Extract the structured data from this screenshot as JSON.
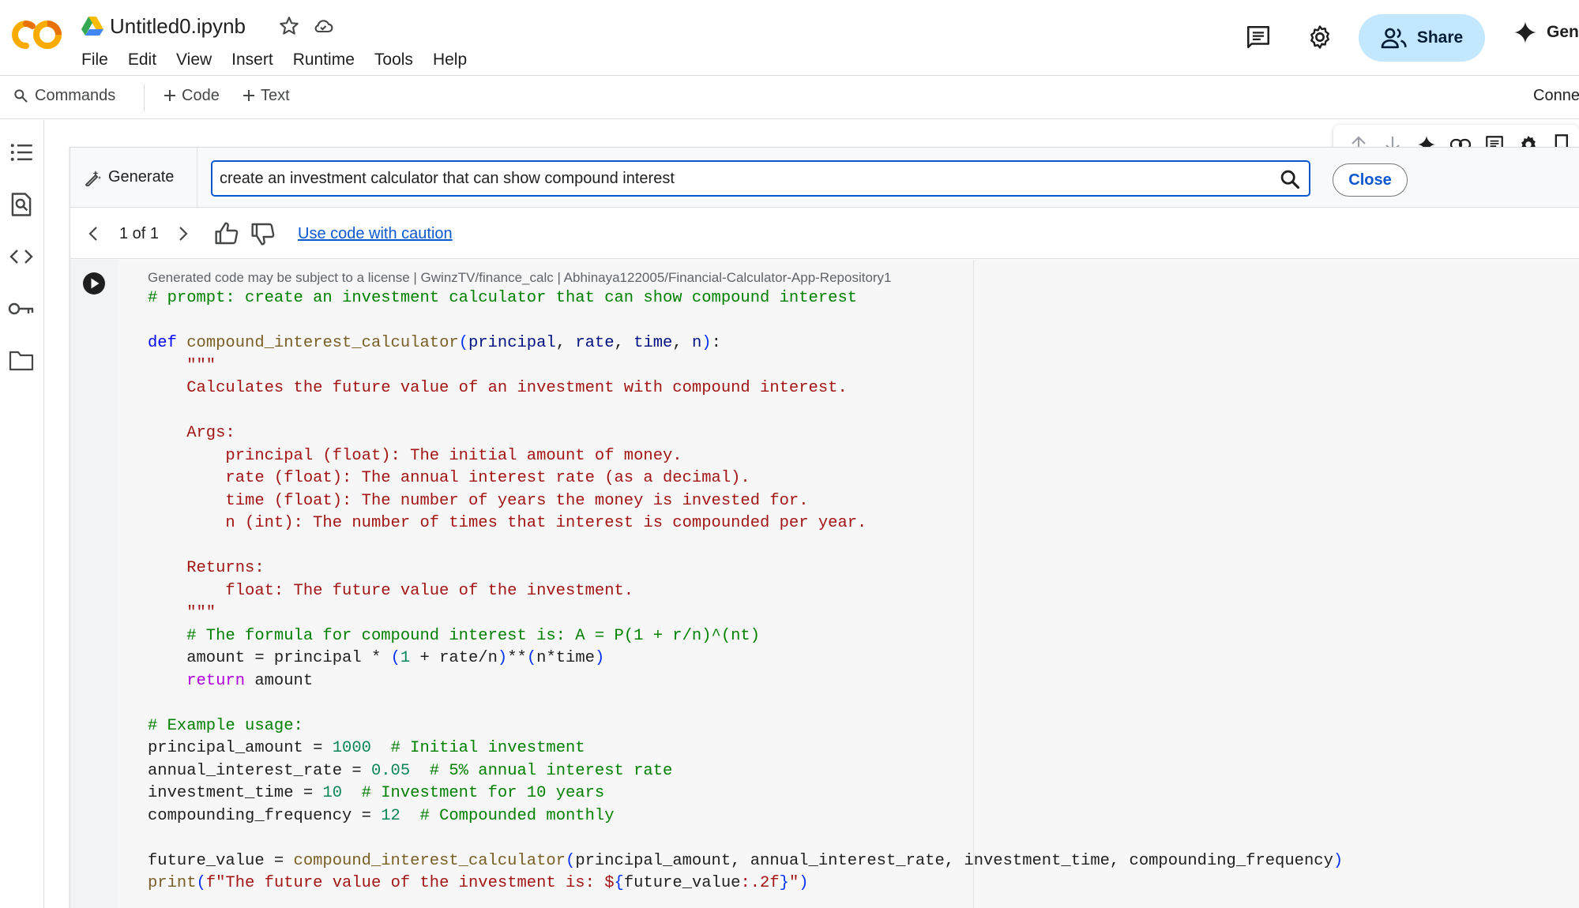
{
  "header": {
    "doc_title": "Untitled0.ipynb",
    "menu": [
      "File",
      "Edit",
      "View",
      "Insert",
      "Runtime",
      "Tools",
      "Help"
    ],
    "share_label": "Share",
    "gemini_label": "Gen"
  },
  "toolbar": {
    "commands_label": "Commands",
    "code_label": "Code",
    "text_label": "Text",
    "connect_label": "Conne"
  },
  "generate": {
    "label": "Generate",
    "prompt": "create an investment calculator that can show compound interest",
    "close_label": "Close"
  },
  "nav": {
    "count": "1 of 1",
    "caution_link": "Use code with caution"
  },
  "code_cell": {
    "license_note": "Generated code may be subject to a license | GwinzTV/finance_calc | Abhinaya122005/Financial-Calculator-App-Repository1",
    "lines": [
      [
        [
          "c",
          "# prompt: create an investment calculator that can show compound interest"
        ]
      ],
      [],
      [
        [
          "k",
          "def "
        ],
        [
          "f",
          "compound_interest_calculator"
        ],
        [
          "b",
          "("
        ],
        [
          "p",
          "principal"
        ],
        [
          "t",
          ", "
        ],
        [
          "p",
          "rate"
        ],
        [
          "t",
          ", "
        ],
        [
          "p",
          "time"
        ],
        [
          "t",
          ", "
        ],
        [
          "p",
          "n"
        ],
        [
          "b",
          ")"
        ],
        [
          "t",
          ":"
        ]
      ],
      [
        [
          "s",
          "    \"\"\""
        ]
      ],
      [
        [
          "s",
          "    Calculates the future value of an investment with compound interest."
        ]
      ],
      [],
      [
        [
          "s",
          "    Args:"
        ]
      ],
      [
        [
          "s",
          "        principal (float): The initial amount of money."
        ]
      ],
      [
        [
          "s",
          "        rate (float): The annual interest rate (as a decimal)."
        ]
      ],
      [
        [
          "s",
          "        time (float): The number of years the money is invested for."
        ]
      ],
      [
        [
          "s",
          "        n (int): The number of times that interest is compounded per year."
        ]
      ],
      [],
      [
        [
          "s",
          "    Returns:"
        ]
      ],
      [
        [
          "s",
          "        float: The future value of the investment."
        ]
      ],
      [
        [
          "s",
          "    \"\"\""
        ]
      ],
      [
        [
          "c",
          "    # The formula for compound interest is: A = P(1 + r/n)^(nt)"
        ]
      ],
      [
        [
          "t",
          "    amount = principal * "
        ],
        [
          "b",
          "("
        ],
        [
          "n",
          "1"
        ],
        [
          "t",
          " + rate/n"
        ],
        [
          "b",
          ")"
        ],
        [
          "t",
          "**"
        ],
        [
          "b",
          "("
        ],
        [
          "t",
          "n*time"
        ],
        [
          "b",
          ")"
        ]
      ],
      [
        [
          "r",
          "    return"
        ],
        [
          "t",
          " amount"
        ]
      ],
      [],
      [
        [
          "c",
          "# Example usage:"
        ]
      ],
      [
        [
          "t",
          "principal_amount = "
        ],
        [
          "n",
          "1000"
        ],
        [
          "c",
          "  # Initial investment"
        ]
      ],
      [
        [
          "t",
          "annual_interest_rate = "
        ],
        [
          "n",
          "0.05"
        ],
        [
          "c",
          "  # 5% annual interest rate"
        ]
      ],
      [
        [
          "t",
          "investment_time = "
        ],
        [
          "n",
          "10"
        ],
        [
          "c",
          "  # Investment for 10 years"
        ]
      ],
      [
        [
          "t",
          "compounding_frequency = "
        ],
        [
          "n",
          "12"
        ],
        [
          "c",
          "  # Compounded monthly"
        ]
      ],
      [],
      [
        [
          "t",
          "future_value = "
        ],
        [
          "f",
          "compound_interest_calculator"
        ],
        [
          "b",
          "("
        ],
        [
          "t",
          "principal_amount, annual_interest_rate, investment_time, compounding_frequency"
        ],
        [
          "b",
          ")"
        ]
      ],
      [
        [
          "f",
          "print"
        ],
        [
          "b",
          "("
        ],
        [
          "s",
          "f\"The future value of the investment is: $"
        ],
        [
          "b",
          "{"
        ],
        [
          "t",
          "future_value"
        ],
        [
          "s",
          ":.2f"
        ],
        [
          "b",
          "}"
        ],
        [
          "s",
          "\""
        ],
        [
          "b",
          ")"
        ]
      ]
    ]
  },
  "colors": {
    "accent_blue": "#0b57d0",
    "share_bg": "#c2e7ff",
    "logo_orange": "#f9ab00",
    "logo_dark_orange": "#e8710a"
  },
  "icons": [
    "colab-logo-icon",
    "drive-icon",
    "star-icon",
    "cloud-icon",
    "comment-icon",
    "gear-icon",
    "people-icon",
    "sparkle-icon",
    "search-icon",
    "plus-icon",
    "toc-icon",
    "find-icon",
    "code-brackets-icon",
    "key-icon",
    "folder-icon",
    "arrow-up-icon",
    "arrow-down-icon",
    "link-icon",
    "pencil-sparkle-icon",
    "chevron-left-icon",
    "chevron-right-icon",
    "thumb-up-icon",
    "thumb-down-icon",
    "play-icon"
  ]
}
